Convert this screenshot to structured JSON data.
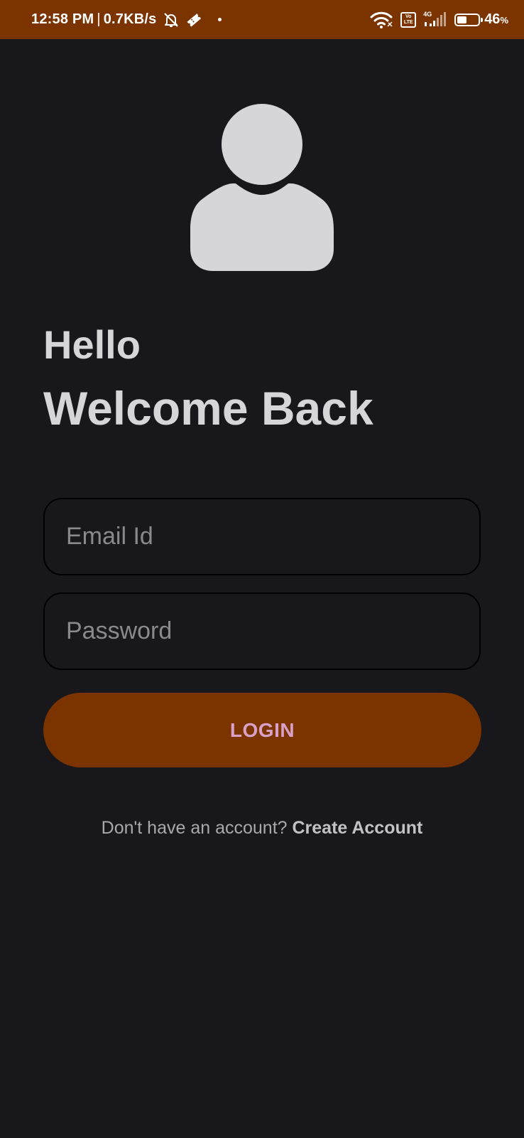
{
  "status_bar": {
    "time": "12:58 PM",
    "separator": "|",
    "speed": "0.7KB/s",
    "volte_label": "Vo LTE",
    "network_label": "4G",
    "battery_percent": "46",
    "battery_unit": "%",
    "battery_level": 0.46,
    "icons": [
      "bell-off-icon",
      "ticket-icon",
      "dot-icon",
      "wifi-icon",
      "volte-icon",
      "signal-icon",
      "battery-icon"
    ]
  },
  "avatar": {
    "icon": "user-icon"
  },
  "greeting": {
    "line1": "Hello",
    "line2": "Welcome Back"
  },
  "form": {
    "email_placeholder": "Email Id",
    "password_placeholder": "Password",
    "login_label": "LOGIN"
  },
  "footer": {
    "prompt": "Don't have an account? ",
    "link": "Create Account"
  },
  "colors": {
    "background": "#18171c",
    "accent": "#7b3300",
    "button_text": "#d9a0c8",
    "text": "#d6d6d8",
    "placeholder": "#8a898e"
  }
}
